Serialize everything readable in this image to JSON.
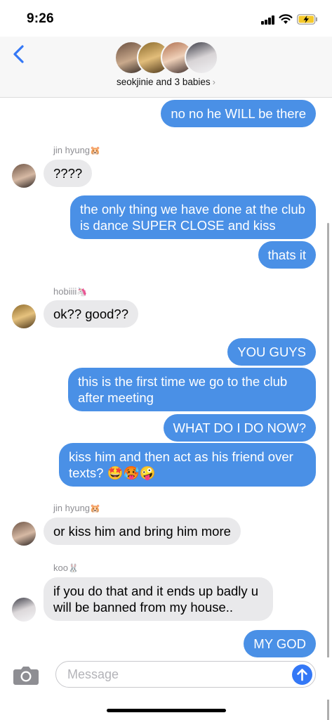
{
  "status_bar": {
    "time": "9:26"
  },
  "header": {
    "group_name": "seokjinie and 3 babies",
    "chevron": "›"
  },
  "messages": [
    {
      "text": "no no he WILL be there"
    },
    {
      "sender": "jin hyung",
      "sender_emoji": "🐹",
      "text": "????"
    },
    {
      "text": "the only thing we have done at the club is dance SUPER CLOSE and kiss"
    },
    {
      "text": "thats it"
    },
    {
      "sender": "hobiiii",
      "sender_emoji": "🦄",
      "text": "ok?? good??"
    },
    {
      "text": "YOU GUYS"
    },
    {
      "text": "this is the first time we go to the club after meeting"
    },
    {
      "text": "WHAT DO I DO NOW?"
    },
    {
      "text": "kiss him and then act as his friend over texts? 🤩🥵🤪"
    },
    {
      "sender": "jin hyung",
      "sender_emoji": "🐹",
      "text": "or kiss him and bring him more"
    },
    {
      "sender": "koo",
      "sender_emoji": "🐰",
      "text": "if you do that and it ends up badly u will be banned from my house.."
    },
    {
      "text": "MY GOD"
    }
  ],
  "composer": {
    "placeholder": "Message"
  },
  "icons": [
    "back-chevron-icon",
    "camera-icon",
    "send-arrow-icon",
    "signal-icon",
    "wifi-icon",
    "battery-charging-icon"
  ],
  "colors": {
    "outgoing_bubble": "#4a90e6",
    "incoming_bubble": "#e9e9eb",
    "accent": "#3478f6"
  }
}
